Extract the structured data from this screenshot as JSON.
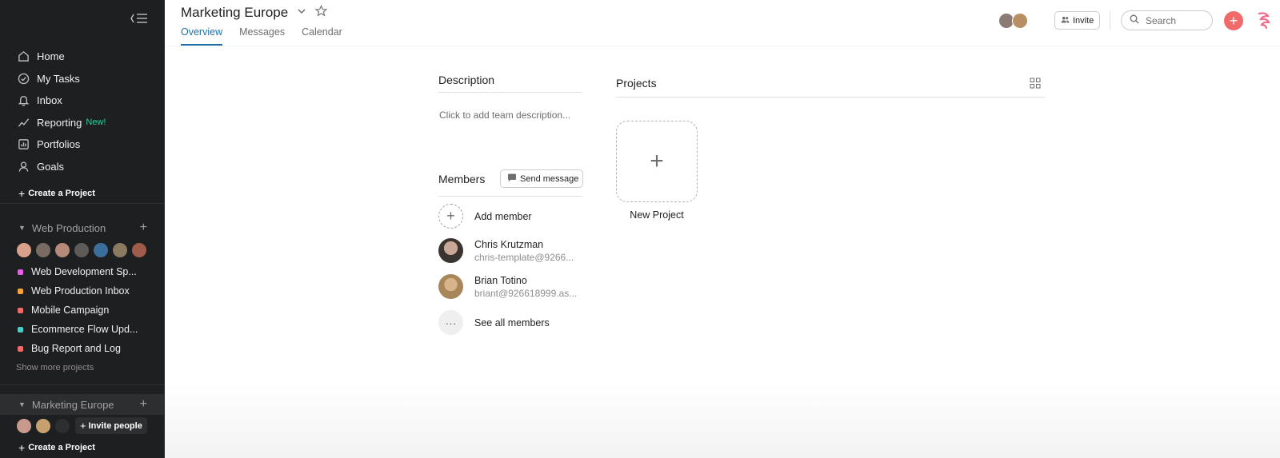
{
  "sidebar": {
    "nav": [
      {
        "label": "Home",
        "icon": "home-icon"
      },
      {
        "label": "My Tasks",
        "icon": "check-circle-icon"
      },
      {
        "label": "Inbox",
        "icon": "bell-icon"
      },
      {
        "label": "Reporting",
        "icon": "trend-line-icon",
        "badge": "New!"
      },
      {
        "label": "Portfolios",
        "icon": "bar-chart-icon"
      },
      {
        "label": "Goals",
        "icon": "person-icon"
      }
    ],
    "create_project_label": "Create a Project",
    "teams": [
      {
        "name": "Web Production",
        "projects": [
          {
            "label": "Web Development Sp...",
            "color": "#e362e3"
          },
          {
            "label": "Web Production Inbox",
            "color": "#f8a23d"
          },
          {
            "label": "Mobile Campaign",
            "color": "#f06a6a"
          },
          {
            "label": "Ecommerce Flow Upd...",
            "color": "#4ecbc4"
          },
          {
            "label": "Bug Report and Log",
            "color": "#f06a6a"
          }
        ],
        "show_more_label": "Show more projects"
      },
      {
        "name": "Marketing Europe",
        "invite_label": "Invite people",
        "create_project_label": "Create a Project"
      }
    ]
  },
  "header": {
    "title": "Marketing Europe",
    "tabs": [
      {
        "label": "Overview",
        "active": true
      },
      {
        "label": "Messages",
        "active": false
      },
      {
        "label": "Calendar",
        "active": false
      }
    ],
    "invite_label": "Invite",
    "search_placeholder": "Search"
  },
  "main": {
    "description": {
      "title": "Description",
      "placeholder": "Click to add team description..."
    },
    "members": {
      "title": "Members",
      "send_message_label": "Send message",
      "add_member_label": "Add member",
      "list": [
        {
          "name": "Chris Krutzman",
          "email": "chris-template@9266..."
        },
        {
          "name": "Brian Totino",
          "email": "briant@926618999.as..."
        }
      ],
      "see_all_label": "See all members"
    },
    "projects": {
      "title": "Projects",
      "new_project_label": "New Project"
    }
  },
  "colors": {
    "sidebar_bg": "#1e1f21",
    "accent_tab": "#1f6fa7",
    "add_button": "#f06a6a",
    "new_badge": "#2ecc9a"
  }
}
